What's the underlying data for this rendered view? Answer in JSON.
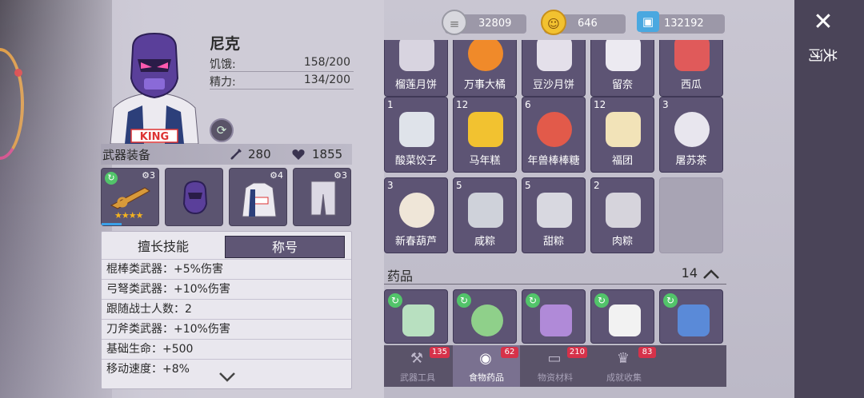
{
  "character": {
    "name": "尼克",
    "hunger_label": "饥饿:",
    "hunger_value": "158/200",
    "energy_label": "精力:",
    "energy_value": "134/200"
  },
  "equipment": {
    "title": "武器装备",
    "attack": "280",
    "health": "1855",
    "slots": [
      {
        "level": "3",
        "stars": "★★★★",
        "xp_fraction": 0.35
      },
      {
        "level": ""
      },
      {
        "level": "4"
      },
      {
        "level": "3"
      }
    ]
  },
  "skills": {
    "tabs": [
      "擅长技能",
      "称号"
    ],
    "active_tab": 1,
    "rows": [
      "棍棒类武器：+5%伤害",
      "弓弩类武器：+10%伤害",
      "跟随战士人数：2",
      "刀斧类武器：+10%伤害",
      "基础生命：+500",
      "移动速度：+8%"
    ]
  },
  "currency": [
    {
      "icon": "coin-stack-icon",
      "value": "32809"
    },
    {
      "icon": "smiley-coin-icon",
      "value": "646"
    },
    {
      "icon": "ticket-icon",
      "value": "132192"
    }
  ],
  "food_items": [
    {
      "count": "",
      "name": "榴莲月饼",
      "color": "#d8d4e0"
    },
    {
      "count": "",
      "name": "万事大橘",
      "color": "#f08a2a"
    },
    {
      "count": "",
      "name": "豆沙月饼",
      "color": "#e4e0ea"
    },
    {
      "count": "",
      "name": "留奈",
      "color": "#eceaf1"
    },
    {
      "count": "",
      "name": "西瓜",
      "color": "#e05a5a"
    },
    {
      "count": "1",
      "name": "酸菜饺子",
      "color": "#dfe3ea"
    },
    {
      "count": "12",
      "name": "马年糕",
      "color": "#f2c230"
    },
    {
      "count": "6",
      "name": "年兽棒棒糖",
      "color": "#e25a4a"
    },
    {
      "count": "12",
      "name": "福团",
      "color": "#f2e3b8"
    },
    {
      "count": "3",
      "name": "屠苏茶",
      "color": "#e8e6ee"
    },
    {
      "count": "3",
      "name": "新春葫芦",
      "color": "#efe6d8"
    },
    {
      "count": "5",
      "name": "咸粽",
      "color": "#cfd2da"
    },
    {
      "count": "5",
      "name": "甜粽",
      "color": "#d8d8e0"
    },
    {
      "count": "2",
      "name": "肉粽",
      "color": "#d6d4dc"
    }
  ],
  "medicine": {
    "title": "药品",
    "count": "14",
    "items": [
      {
        "color": "#b8e0c0"
      },
      {
        "color": "#8fd08a"
      },
      {
        "color": "#b08ad8"
      },
      {
        "color": "#f2f2f2"
      },
      {
        "color": "#5a8ad8"
      }
    ]
  },
  "bottom_tabs": [
    {
      "label": "武器工具",
      "badge": "135",
      "icon": "axe-icon"
    },
    {
      "label": "食物药品",
      "badge": "62",
      "icon": "food-icon"
    },
    {
      "label": "物资材料",
      "badge": "210",
      "icon": "log-icon"
    },
    {
      "label": "成就收集",
      "badge": "83",
      "icon": "trophy-icon"
    }
  ],
  "active_bottom_tab": 1,
  "close": {
    "label": "关闭"
  }
}
